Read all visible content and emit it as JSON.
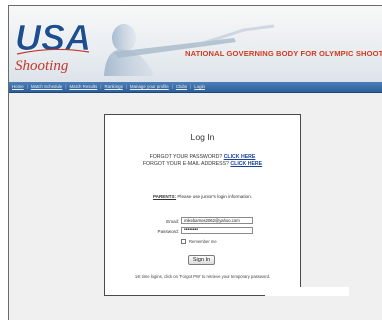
{
  "banner": {
    "logo_line1": "USA",
    "logo_line2": "Shooting",
    "tagline": "NATIONAL GOVERNING BODY FOR OLYMPIC SHOOTING SPO"
  },
  "nav": {
    "items": [
      "Home",
      "Match Schedule",
      "Match Results",
      "Rankings",
      "Manage your profile",
      "Clubs",
      "Login"
    ],
    "separator": "|"
  },
  "login": {
    "title": "Log In",
    "forgot_password_text": "FORGOT YOUR PASSWORD?",
    "forgot_password_link": "CLICK HERE",
    "forgot_email_text": "FORGOT YOUR E-MAIL ADDRESS?",
    "forgot_email_link": "CLICK HERE",
    "parents_label": "PARENTS:",
    "parents_text": " Please use junior's login information.",
    "email_label": "Email:",
    "email_value": "mikebarnes2062@yahoo.com",
    "password_label": "Password:",
    "password_value": "••••••••",
    "remember_label": "Remember me",
    "remember_checked": false,
    "signin_label": "Sign In",
    "note": "1st time logins, click on 'Forgot PW' to retrieve your temporary password."
  }
}
